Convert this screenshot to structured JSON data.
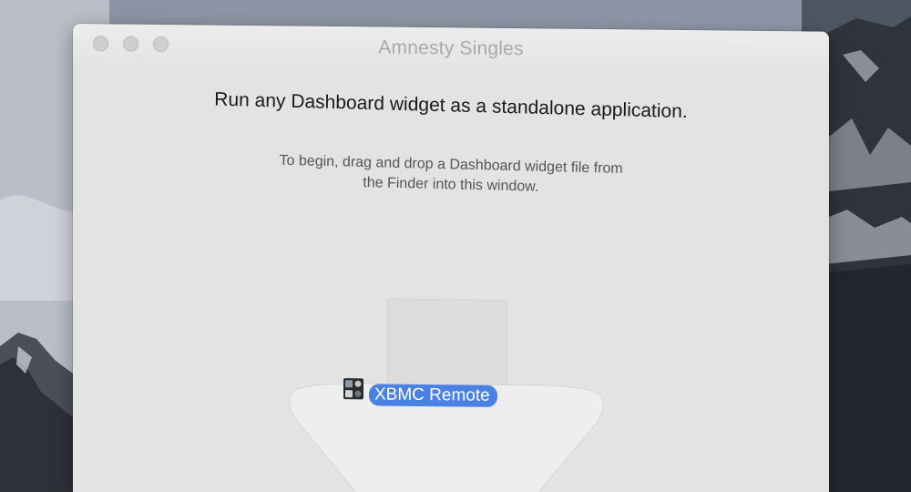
{
  "window": {
    "title": "Amnesty Singles",
    "traffic_lights": [
      "close",
      "minimize",
      "zoom"
    ]
  },
  "main": {
    "headline": "Run any Dashboard widget as a standalone application.",
    "instructions_line1": "To begin, drag and drop a Dashboard widget file from",
    "instructions_line2": "the Finder into this window."
  },
  "drag": {
    "file_label": "XBMC Remote",
    "icon": "widget-file-icon",
    "label_color": "#4a82e4"
  },
  "colors": {
    "window_bg": "#e3e3e3",
    "title_text": "#a9a9a9",
    "selection_blue": "#4a82e4"
  }
}
